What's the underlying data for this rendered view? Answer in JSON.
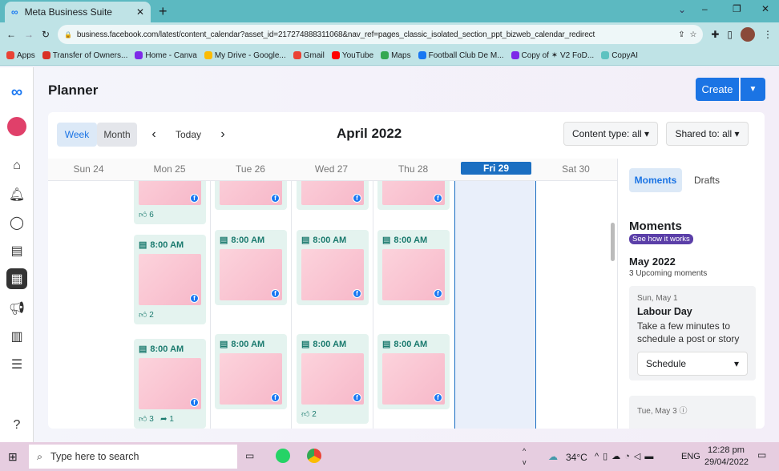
{
  "browser": {
    "tab_title": "Meta Business Suite",
    "url": "business.facebook.com/latest/content_calendar?asset_id=217274888311068&nav_ref=pages_classic_isolated_section_ppt_bizweb_calendar_redirect",
    "bookmarks": [
      {
        "label": "Apps",
        "color": "#e94235"
      },
      {
        "label": "Transfer of Owners...",
        "color": "#d93025"
      },
      {
        "label": "Home - Canva",
        "color": "#7d2ae8"
      },
      {
        "label": "My Drive - Google...",
        "color": "#fbbc04"
      },
      {
        "label": "Gmail",
        "color": "#ea4335"
      },
      {
        "label": "YouTube",
        "color": "#ff0000"
      },
      {
        "label": "Maps",
        "color": "#34a853"
      },
      {
        "label": "Football Club De M...",
        "color": "#1877f2"
      },
      {
        "label": "Copy of ✶ V2 FoD...",
        "color": "#7d2ae8"
      },
      {
        "label": "CopyAI",
        "color": "#5ec2c0"
      }
    ]
  },
  "page": {
    "title": "Planner",
    "create": "Create"
  },
  "toolbar": {
    "week": "Week",
    "month": "Month",
    "today": "Today",
    "current_month": "April 2022",
    "content_type": "Content type: all",
    "shared_to": "Shared to: all"
  },
  "days": [
    "Sun 24",
    "Mon 25",
    "Tue 26",
    "Wed 27",
    "Thu 28",
    "Fri 29",
    "Sat 30"
  ],
  "posts": [
    {
      "col": 1,
      "row": 0,
      "time": "",
      "likes": "6",
      "shares": ""
    },
    {
      "col": 2,
      "row": 0,
      "time": "",
      "likes": "",
      "shares": ""
    },
    {
      "col": 3,
      "row": 0,
      "time": "",
      "likes": "",
      "shares": ""
    },
    {
      "col": 4,
      "row": 0,
      "time": "",
      "likes": "",
      "shares": ""
    },
    {
      "col": 1,
      "row": 1,
      "time": "8:00 AM",
      "likes": "2",
      "shares": ""
    },
    {
      "col": 2,
      "row": 1,
      "time": "8:00 AM",
      "likes": "",
      "shares": ""
    },
    {
      "col": 3,
      "row": 1,
      "time": "8:00 AM",
      "likes": "",
      "shares": ""
    },
    {
      "col": 4,
      "row": 1,
      "time": "8:00 AM",
      "likes": "",
      "shares": ""
    },
    {
      "col": 1,
      "row": 2,
      "time": "8:00 AM",
      "likes": "3",
      "shares": "1"
    },
    {
      "col": 2,
      "row": 2,
      "time": "8:00 AM",
      "likes": "",
      "shares": ""
    },
    {
      "col": 3,
      "row": 2,
      "time": "8:00 AM",
      "likes": "2",
      "shares": ""
    },
    {
      "col": 4,
      "row": 2,
      "time": "8:00 AM",
      "likes": "",
      "shares": ""
    }
  ],
  "panel": {
    "tab_moments": "Moments",
    "tab_drafts": "Drafts",
    "heading": "Moments",
    "badge": "See how it works",
    "month": "May 2022",
    "count": "3 Upcoming moments",
    "moment1": {
      "date": "Sun, May 1",
      "name": "Labour Day",
      "desc": "Take a few minutes to schedule a post or story",
      "action": "Schedule"
    },
    "moment2": {
      "date": "Tue, May 3"
    }
  },
  "taskbar": {
    "search": "Type here to search",
    "temp": "34°C",
    "lang": "ENG",
    "time": "12:28 pm",
    "date": "29/04/2022"
  }
}
